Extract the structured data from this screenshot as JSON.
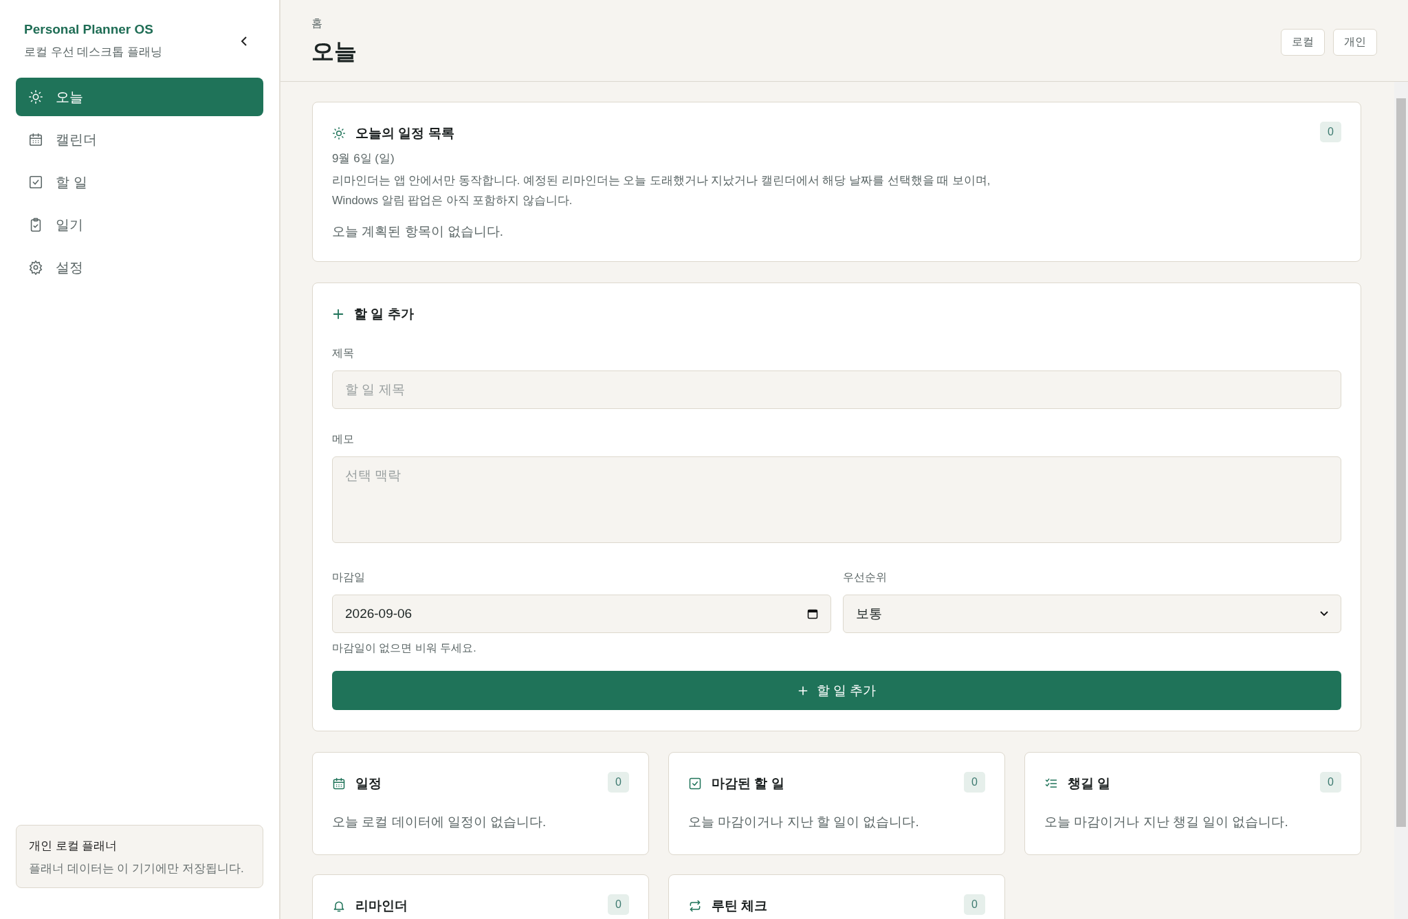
{
  "sidebar": {
    "app_title": "Personal Planner OS",
    "subtitle": "로컬 우선 데스크톱 플래닝",
    "nav": [
      {
        "label": "오늘",
        "kind": "sun",
        "selected": true
      },
      {
        "label": "캘린더",
        "kind": "calendar",
        "selected": false
      },
      {
        "label": "할 일",
        "kind": "check",
        "selected": false
      },
      {
        "label": "일기",
        "kind": "clipboard",
        "selected": false
      },
      {
        "label": "설정",
        "kind": "gear",
        "selected": false
      }
    ],
    "footer": {
      "title": "개인 로컬 플래너",
      "text": "플래너 데이터는 이 기기에만 저장됩니다."
    }
  },
  "header": {
    "breadcrumb": "홈",
    "title": "오늘",
    "badges": [
      "로컬",
      "개인"
    ]
  },
  "agenda": {
    "title": "오늘의 일정 목록",
    "count": "0",
    "date": "9월 6일 (일)",
    "notice": "리마인더는 앱 안에서만 동작합니다. 예정된 리마인더는 오늘 도래했거나 지났거나 캘린더에서 해당 날짜를 선택했을 때 보이며, Windows 알림 팝업은 아직 포함하지 않습니다.",
    "empty": "오늘 계획된 항목이 없습니다."
  },
  "add_task": {
    "title": "할 일 추가",
    "title_field": {
      "label": "제목",
      "placeholder": "할 일 제목"
    },
    "memo_field": {
      "label": "메모",
      "placeholder": "선택 맥락"
    },
    "due_field": {
      "label": "마감일",
      "value": "2026-09-06",
      "hint": "마감일이 없으면 비워 두세요."
    },
    "priority_field": {
      "label": "우선순위",
      "value": "보통"
    },
    "submit": "할 일 추가"
  },
  "summary_cards": [
    {
      "title": "일정",
      "kind": "calendar",
      "count": "0",
      "empty": "오늘 로컬 데이터에 일정이 없습니다."
    },
    {
      "title": "마감된 할 일",
      "kind": "check",
      "count": "0",
      "empty": "오늘 마감이거나 지난 할 일이 없습니다."
    },
    {
      "title": "챙길 일",
      "kind": "list",
      "count": "0",
      "empty": "오늘 마감이거나 지난 챙길 일이 없습니다."
    },
    {
      "title": "리마인더",
      "kind": "bell",
      "count": "0"
    },
    {
      "title": "루틴 체크",
      "kind": "repeat",
      "count": "0"
    }
  ]
}
